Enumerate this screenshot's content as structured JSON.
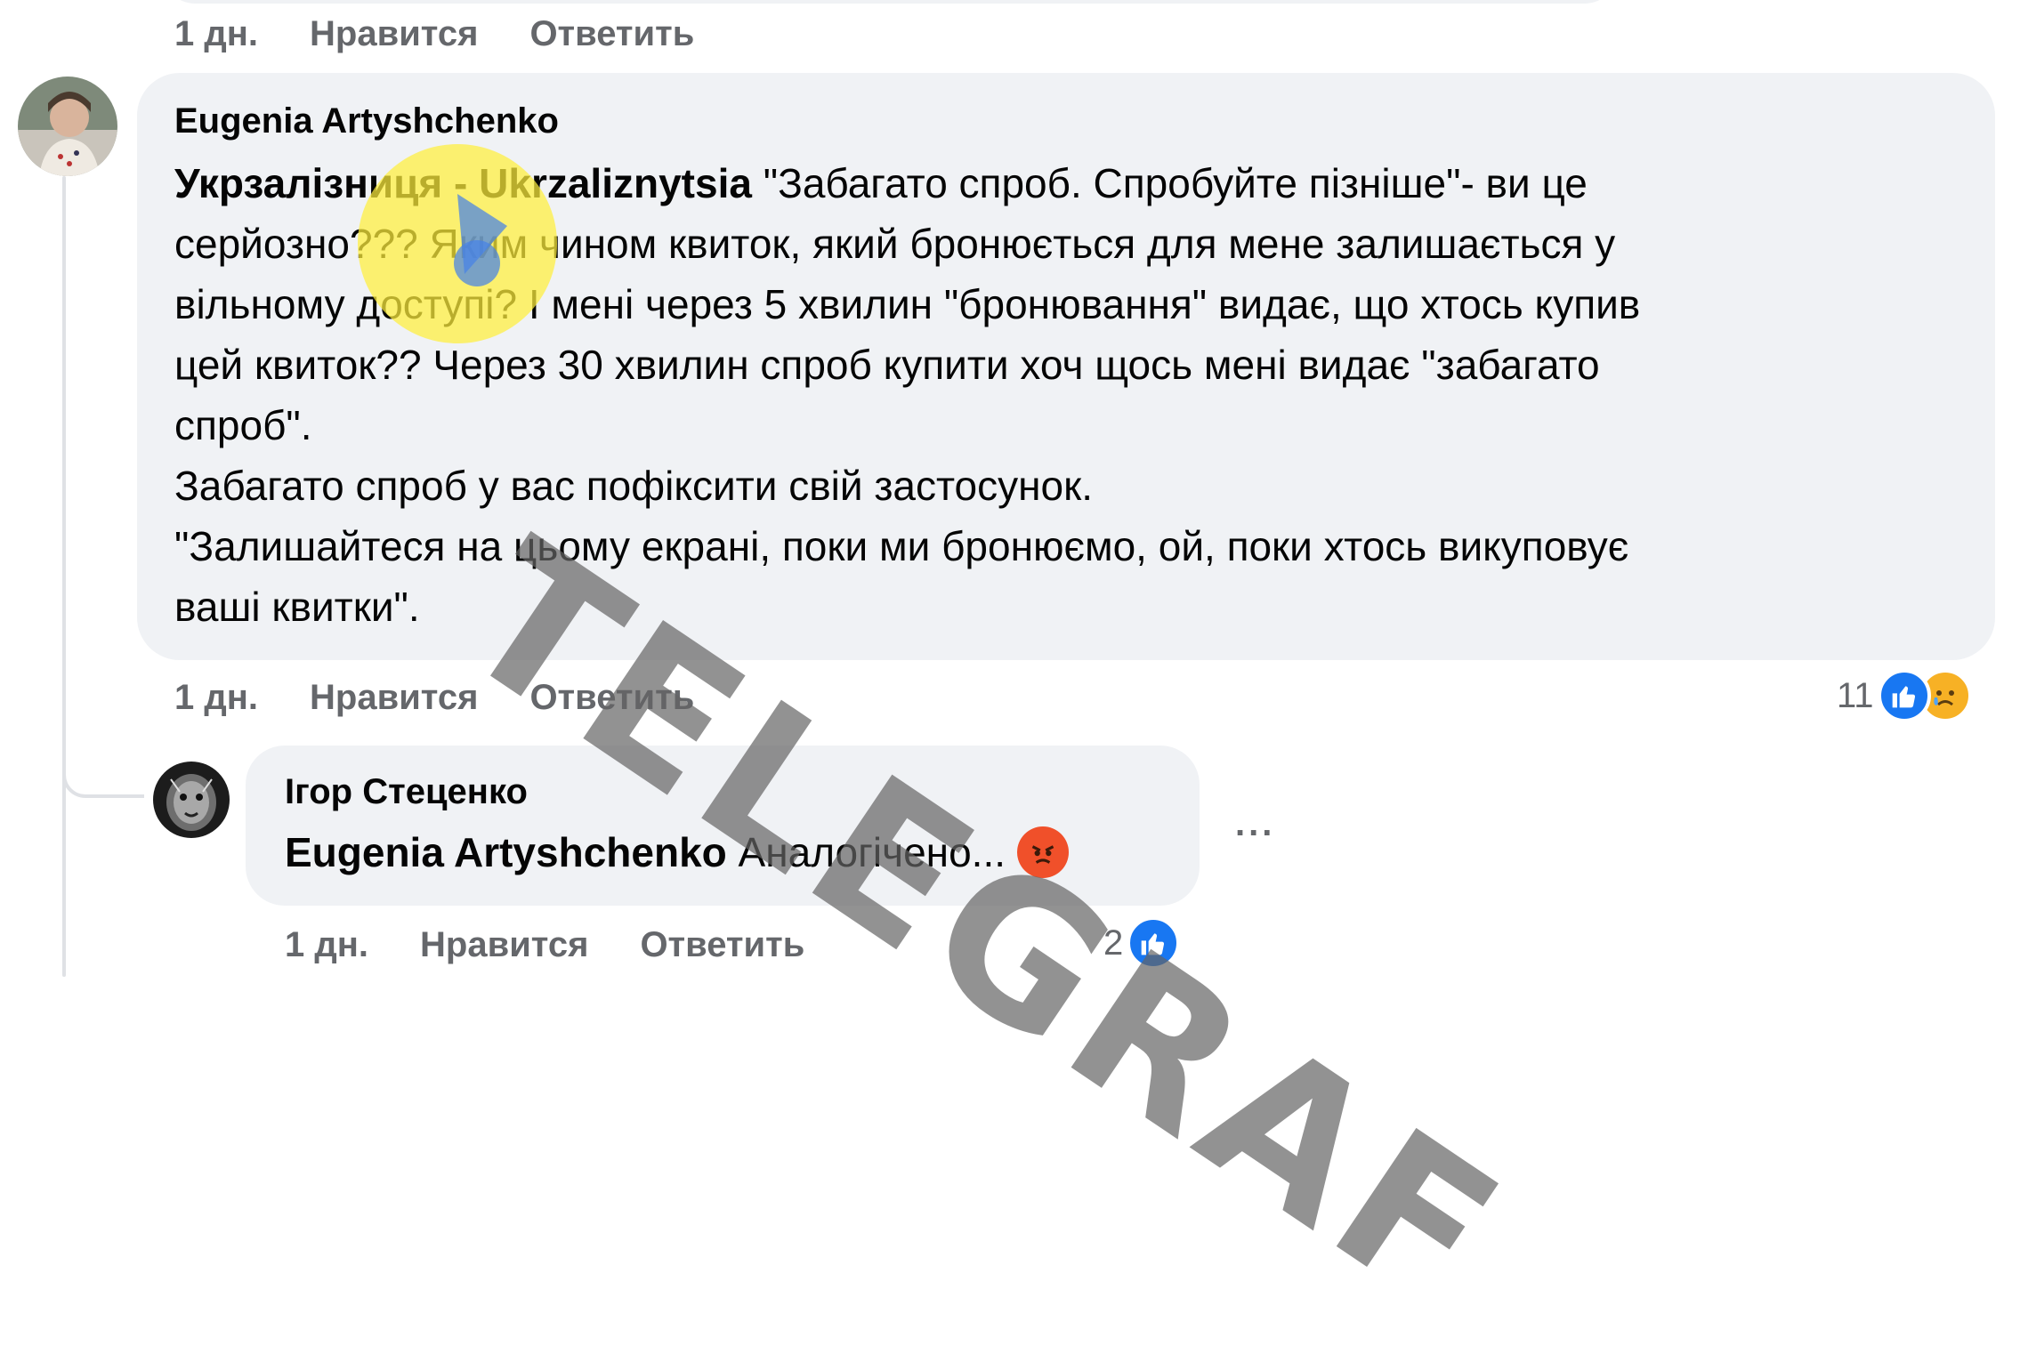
{
  "top_actions": {
    "time": "1 дн.",
    "like": "Нравится",
    "reply": "Ответить"
  },
  "comment1": {
    "author": "Eugenia Artyshchenko",
    "mention": "Укрзалізниця - Ukrzaliznytsia",
    "line1_rest": " \"Забагато спроб. Спробуйте пізніше\"- ви це",
    "line2": "серйозно??? Яким чином квиток, який бронюється для мене залишається у",
    "line3": "вільному доступі? І мені через 5 хвилин \"бронювання\" видає, що хтось купив",
    "line4": "цей квиток?? Через 30 хвилин спроб купити хоч щось мені видає \"забагато",
    "line5": "спроб\".",
    "line6": "Забагато спроб у вас пофіксити свій застосунок.",
    "line7": "\"Залишайтеся на цьому екрані, поки ми бронюємо, ой, поки хтось викуповує",
    "line8": "ваші квитки\".",
    "actions": {
      "time": "1 дн.",
      "like": "Нравится",
      "reply": "Ответить"
    },
    "reaction_count": "11",
    "reaction_icons": [
      "thumbs-up-icon",
      "sad-face-icon"
    ]
  },
  "reply1": {
    "author": "Ігор Стеценко",
    "mention": "Eugenia Artyshchenko",
    "text": " Аналогічено... ",
    "emoji": "angry-face-icon",
    "more": "...",
    "actions": {
      "time": "1 дн.",
      "like": "Нравится",
      "reply": "Ответить"
    },
    "reaction_count": "2",
    "reaction_icons": [
      "thumbs-up-icon"
    ]
  },
  "watermark": {
    "text": "TELEGRAF"
  },
  "colors": {
    "bubble": "#f0f2f5",
    "meta": "#65676b",
    "like_blue": "#1877f2",
    "watermark_yellow": "#ffef3c"
  }
}
